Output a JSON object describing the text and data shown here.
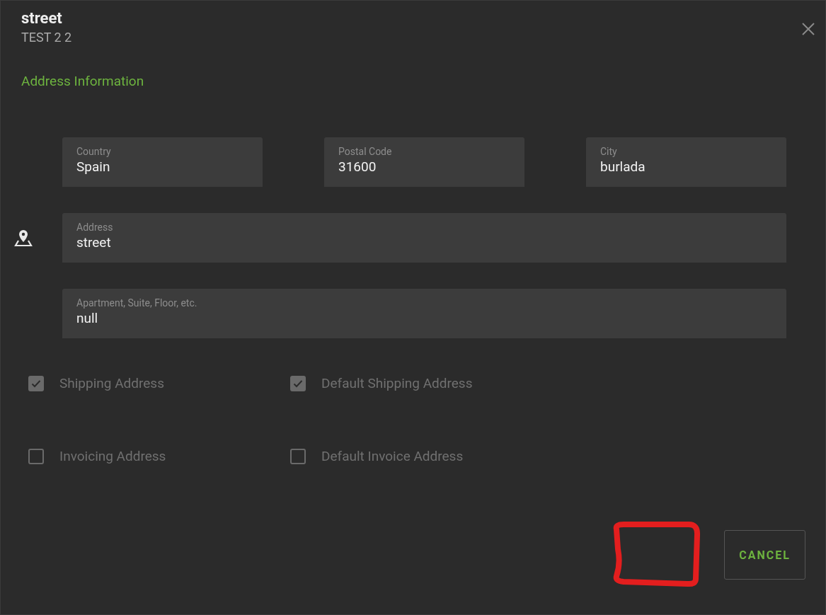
{
  "header": {
    "title": "street",
    "subtitle": "TEST 2 2"
  },
  "section_title": "Address Information",
  "top_fields": [
    {
      "label": "Country",
      "value": "Spain"
    },
    {
      "label": "Postal Code",
      "value": "31600"
    },
    {
      "label": "City",
      "value": "burlada"
    }
  ],
  "wide_fields": [
    {
      "label": "Address",
      "value": "street",
      "icon": true
    },
    {
      "label": "Apartment, Suite, Floor, etc.",
      "value": "null",
      "icon": false
    }
  ],
  "checkboxes": [
    {
      "label": "Shipping Address",
      "checked": true,
      "disabled": true
    },
    {
      "label": "Default Shipping Address",
      "checked": true,
      "disabled": true
    },
    {
      "label": "Invoicing Address",
      "checked": false,
      "disabled": true
    },
    {
      "label": "Default Invoice Address",
      "checked": false,
      "disabled": true
    }
  ],
  "buttons": [
    {
      "label": "CANCEL"
    }
  ]
}
